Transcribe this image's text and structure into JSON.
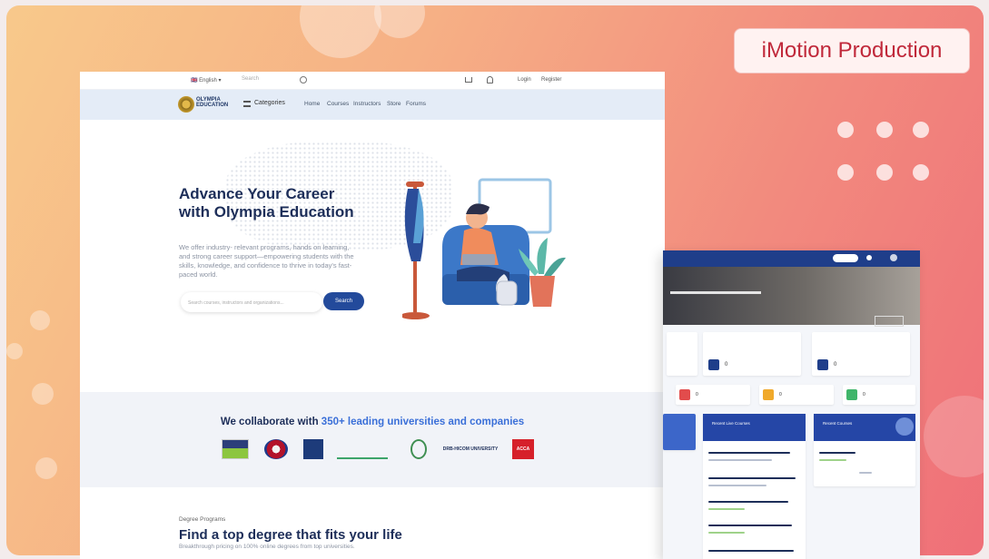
{
  "badge": {
    "label": "iMotion Production"
  },
  "topbar": {
    "language": "🇬🇧 English ▾",
    "search_placeholder": "Search",
    "login": "Login",
    "register": "Register"
  },
  "navbar": {
    "logo_text": "OLYMPIA EDUCATION",
    "categories_label": "Categories",
    "links": [
      "Home",
      "Courses",
      "Instructors",
      "Store",
      "Forums"
    ]
  },
  "hero": {
    "title": "Advance Your Career with Olympia Education",
    "subtitle": "We offer industry- relevant programs, hands on learning, and strong career support—empowering students with the skills, knowledge, and confidence to thrive in today's fast-paced world.",
    "search_placeholder": "Search courses, instructors and organizations...",
    "search_button": "Search"
  },
  "collab": {
    "title_prefix": "We collaborate with ",
    "title_highlight": "350+ leading universities and companies",
    "partners": [
      "",
      "",
      "",
      "",
      "",
      "DRB-HICOM UNIVERSITY",
      "ACCA"
    ]
  },
  "degree": {
    "kicker": "Degree Programs",
    "title": "Find a top degree that fits your life",
    "subtitle": "Breakthrough pricing on 100% online degrees from top universities."
  },
  "dashboard": {
    "stat_values": [
      "0",
      "0",
      "0",
      "0",
      "0"
    ],
    "panels": [
      {
        "title": "Recent Live Courses"
      },
      {
        "title": "Recent Courses"
      }
    ],
    "tile_colors": [
      "#e24c4c",
      "#f0a92b",
      "#3fb56a",
      "#1f3e8a"
    ]
  },
  "colors": {
    "brand_navy": "#1d2e59",
    "accent_blue": "#234a9b",
    "badge_red": "#c0283a"
  }
}
